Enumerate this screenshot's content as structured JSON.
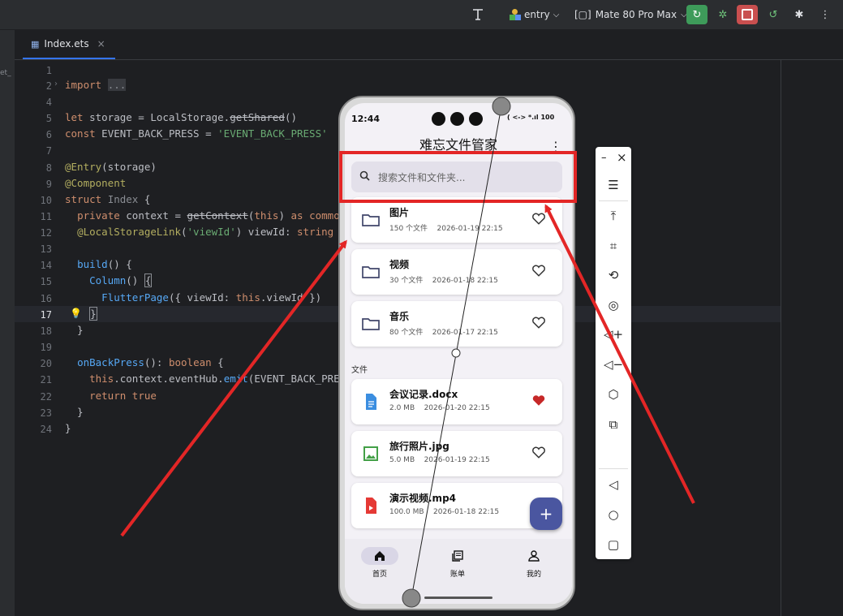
{
  "toolbar": {
    "text_icon": "text-tool-icon",
    "module": "entry",
    "device": "Mate 80 Pro Max",
    "colors": {
      "run": "#3e9b5a",
      "stop": "#c94f4f"
    }
  },
  "editor": {
    "tab_label": "Index.ets",
    "tab_close": "×",
    "left_fragment": "et_",
    "line_numbers": [
      "1",
      "2",
      "4",
      "5",
      "6",
      "7",
      "8",
      "9",
      "10",
      "11",
      "12",
      "13",
      "14",
      "15",
      "16",
      "17",
      "18",
      "19",
      "20",
      "21",
      "22",
      "23",
      "24"
    ],
    "current_line": "17"
  },
  "phone": {
    "time": "12:44",
    "status_right": "( <-> *.ıl 100",
    "battery": "100",
    "title": "难忘文件管家",
    "search_placeholder": "搜索文件和文件夹...",
    "folders": [
      {
        "name": "图片",
        "count": "150 个文件",
        "date": "2026-01-19 22:15",
        "favorite": false
      },
      {
        "name": "视频",
        "count": "30 个文件",
        "date": "2026-01-18 22:15",
        "favorite": false
      },
      {
        "name": "音乐",
        "count": "80 个文件",
        "date": "2026-01-17 22:15",
        "favorite": false
      }
    ],
    "files_header": "文件",
    "files": [
      {
        "name": "会议记录.docx",
        "size": "2.0 MB",
        "date": "2026-01-20 22:15",
        "favorite": true,
        "icon": "document-icon",
        "color": "#3b8ee0"
      },
      {
        "name": "旅行照片.jpg",
        "size": "5.0 MB",
        "date": "2026-01-19 22:15",
        "favorite": false,
        "icon": "image-icon",
        "color": "#43a047"
      },
      {
        "name": "演示视频.mp4",
        "size": "100.0 MB",
        "date": "2026-01-18 22:15",
        "favorite": false,
        "icon": "video-icon",
        "color": "#e53935"
      }
    ],
    "fab_label": "+",
    "nav": [
      {
        "label": "首页",
        "icon": "home-icon",
        "active": true
      },
      {
        "label": "账单",
        "icon": "bill-icon",
        "active": false
      },
      {
        "label": "我的",
        "icon": "profile-icon",
        "active": false
      }
    ]
  },
  "side_panel": {
    "buttons": [
      "minimize-icon",
      "close-icon",
      "menu-icon",
      "top-icon",
      "crop-icon",
      "rotate-icon",
      "screenshot-icon",
      "volume-up-icon",
      "volume-down-icon",
      "fold-icon",
      "multi-device-icon",
      "back-icon",
      "home-icon",
      "recents-icon"
    ],
    "minimize_label": "–",
    "close_label": "×"
  },
  "annotation": {
    "highlight_color": "#e32626"
  }
}
